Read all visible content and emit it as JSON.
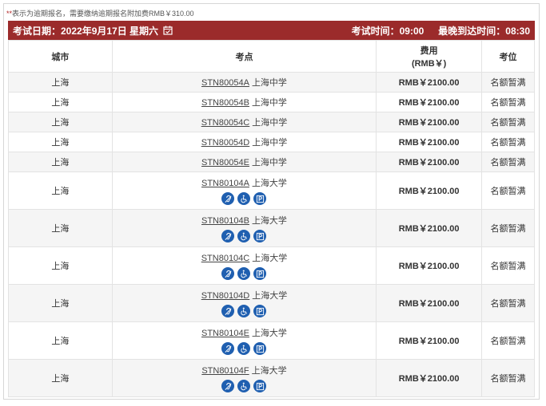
{
  "note": {
    "star": "**",
    "text": "表示为逾期报名，需要缴纳逾期报名附加费RMB￥310.00"
  },
  "header": {
    "date_label": "考试日期：2022年9月17日 星期六",
    "exam_time": "考试时间：09:00",
    "arrival_time": "最晚到达时间：08:30"
  },
  "table": {
    "columns": [
      "城市",
      "考点",
      "费用",
      "(RMB￥)",
      "考位"
    ],
    "rows": [
      {
        "city": "上海",
        "code": "STN80054A",
        "name": "上海中学",
        "fee": "RMB￥2100.00",
        "status": "名额暂满",
        "icons": false
      },
      {
        "city": "上海",
        "code": "STN80054B",
        "name": "上海中学",
        "fee": "RMB￥2100.00",
        "status": "名额暂满",
        "icons": false
      },
      {
        "city": "上海",
        "code": "STN80054C",
        "name": "上海中学",
        "fee": "RMB￥2100.00",
        "status": "名额暂满",
        "icons": false
      },
      {
        "city": "上海",
        "code": "STN80054D",
        "name": "上海中学",
        "fee": "RMB￥2100.00",
        "status": "名额暂满",
        "icons": false
      },
      {
        "city": "上海",
        "code": "STN80054E",
        "name": "上海中学",
        "fee": "RMB￥2100.00",
        "status": "名额暂满",
        "icons": false
      },
      {
        "city": "上海",
        "code": "STN80104A",
        "name": "上海大学",
        "fee": "RMB￥2100.00",
        "status": "名额暂满",
        "icons": true
      },
      {
        "city": "上海",
        "code": "STN80104B",
        "name": "上海大学",
        "fee": "RMB￥2100.00",
        "status": "名额暂满",
        "icons": true
      },
      {
        "city": "上海",
        "code": "STN80104C",
        "name": "上海大学",
        "fee": "RMB￥2100.00",
        "status": "名额暂满",
        "icons": true
      },
      {
        "city": "上海",
        "code": "STN80104D",
        "name": "上海大学",
        "fee": "RMB￥2100.00",
        "status": "名额暂满",
        "icons": true
      },
      {
        "city": "上海",
        "code": "STN80104E",
        "name": "上海大学",
        "fee": "RMB￥2100.00",
        "status": "名额暂满",
        "icons": true
      },
      {
        "city": "上海",
        "code": "STN80104F",
        "name": "上海大学",
        "fee": "RMB￥2100.00",
        "status": "名额暂满",
        "icons": true
      }
    ]
  },
  "icon_names": [
    "hearing-accessibility-icon",
    "wheelchair-accessibility-icon",
    "parking-icon"
  ],
  "colors": {
    "header_bg": "#9b2b2b",
    "icon_bg": "#1f5fb0"
  }
}
